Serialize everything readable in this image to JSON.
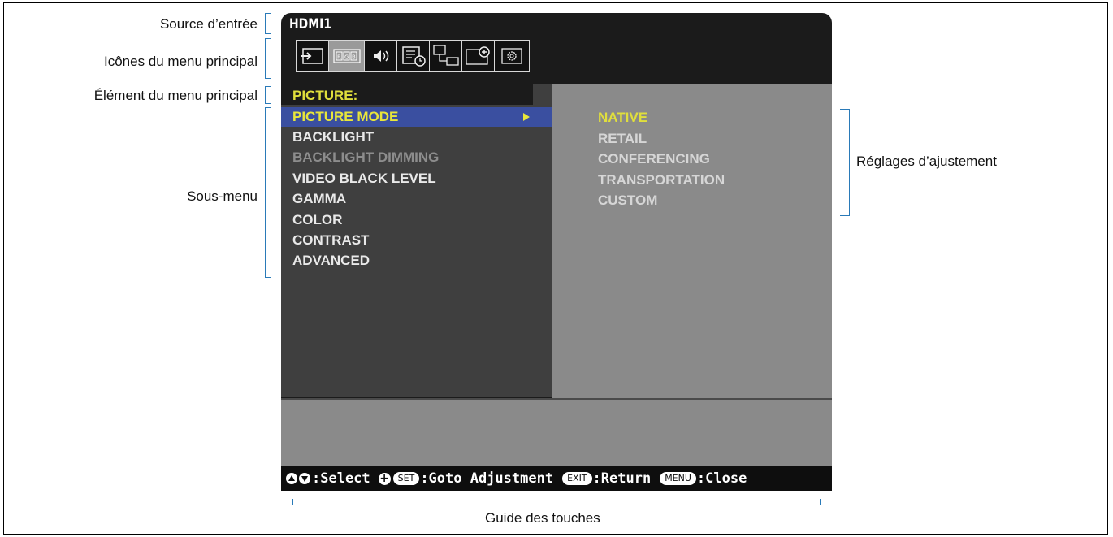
{
  "callouts": {
    "input_source": "Source d’entrée",
    "main_menu_icons": "Icônes du menu principal",
    "main_menu_item": "Élément du menu principal",
    "submenu": "Sous-menu",
    "adjustment_settings": "Réglages d’ajustement",
    "key_guide": "Guide des touches"
  },
  "osd": {
    "source": "HDMI1",
    "menu_icons": [
      "input-icon",
      "picture-rgb-icon",
      "audio-icon",
      "schedule-icon",
      "network-icon",
      "protect-icon",
      "system-icon"
    ],
    "selected_icon_index": 1,
    "menu_title": "PICTURE:",
    "submenu_items": [
      {
        "label": "PICTURE MODE",
        "state": "active"
      },
      {
        "label": "BACKLIGHT",
        "state": "normal"
      },
      {
        "label": "BACKLIGHT DIMMING",
        "state": "disabled"
      },
      {
        "label": "VIDEO BLACK LEVEL",
        "state": "normal"
      },
      {
        "label": "GAMMA",
        "state": "normal"
      },
      {
        "label": "COLOR",
        "state": "normal"
      },
      {
        "label": "CONTRAST",
        "state": "normal"
      },
      {
        "label": "ADVANCED",
        "state": "normal"
      }
    ],
    "options": [
      {
        "label": "NATIVE",
        "selected": true
      },
      {
        "label": "RETAIL",
        "selected": false
      },
      {
        "label": "CONFERENCING",
        "selected": false
      },
      {
        "label": "TRANSPORTATION",
        "selected": false
      },
      {
        "label": "CUSTOM",
        "selected": false
      }
    ],
    "key_guide": {
      "select": ":Select",
      "set_key": "SET",
      "goto": ":Goto Adjustment",
      "exit_key": "EXIT",
      "return": ":Return",
      "menu_key": "MENU",
      "close": ":Close"
    }
  },
  "colors": {
    "highlight_text": "#e0df3c",
    "active_row": "#3a4fa0",
    "bracket": "#2a7ab8"
  }
}
